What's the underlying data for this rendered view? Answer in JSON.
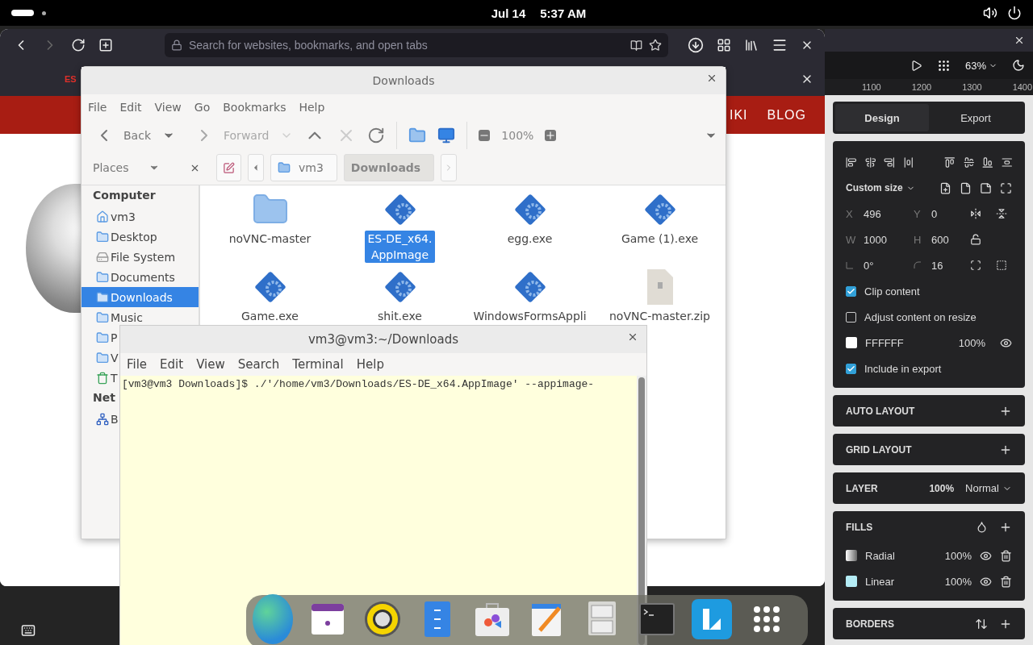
{
  "top_bar": {
    "date": "Jul 14",
    "time": "5:37 AM"
  },
  "browser": {
    "search_placeholder": "Search for websites, bookmarks, and open tabs",
    "tab_label": "ES",
    "site_nav": [
      "IKI",
      "BLOG"
    ]
  },
  "file_manager": {
    "title": "Downloads",
    "menu": [
      "File",
      "Edit",
      "View",
      "Go",
      "Bookmarks",
      "Help"
    ],
    "toolbar": {
      "back": "Back",
      "forward": "Forward",
      "forward_disabled": true,
      "zoom": "100%"
    },
    "places": "Places",
    "path": [
      {
        "label": "vm3",
        "selected": false
      },
      {
        "label": "Downloads",
        "selected": true
      }
    ],
    "sidebar": [
      {
        "heading": "Computer",
        "items": [
          {
            "label": "vm3",
            "kind": "home",
            "selected": false
          },
          {
            "label": "Desktop",
            "kind": "folder",
            "selected": false
          },
          {
            "label": "File System",
            "kind": "drive",
            "selected": false
          },
          {
            "label": "Documents",
            "kind": "folder",
            "selected": false
          },
          {
            "label": "Downloads",
            "kind": "folder",
            "selected": true
          },
          {
            "label": "Music",
            "kind": "folder",
            "selected": false
          },
          {
            "label": "P",
            "kind": "folder",
            "selected": false
          },
          {
            "label": "V",
            "kind": "folder",
            "selected": false
          },
          {
            "label": "T",
            "kind": "trash",
            "selected": false
          }
        ]
      },
      {
        "heading": "Net",
        "items": [
          {
            "label": "B",
            "kind": "network",
            "selected": false
          }
        ]
      }
    ],
    "files": [
      {
        "name": "noVNC-master",
        "kind": "folder",
        "selected": false
      },
      {
        "name": "ES-DE_x64.\nAppImage",
        "kind": "program",
        "selected": true
      },
      {
        "name": "egg.exe",
        "kind": "program",
        "selected": false
      },
      {
        "name": "Game (1).exe",
        "kind": "program",
        "selected": false
      },
      {
        "name": "Game.exe",
        "kind": "program",
        "selected": false
      },
      {
        "name": "shit.exe",
        "kind": "program",
        "selected": false
      },
      {
        "name": "WindowsFormsAppli",
        "kind": "program",
        "selected": false
      },
      {
        "name": "noVNC-master.zip",
        "kind": "archive",
        "selected": false
      }
    ]
  },
  "terminal": {
    "title": "vm3@vm3:~/Downloads",
    "menu": [
      "File",
      "Edit",
      "View",
      "Search",
      "Terminal",
      "Help"
    ],
    "lines": [
      "[vm3@vm3 Downloads]$ ./'/home/vm3/Downloads/ES-DE_x64.AppImage' --appimage-"
    ]
  },
  "design_app": {
    "zoom": "63%",
    "ruler": [
      "1100",
      "1200",
      "1300",
      "1400"
    ],
    "tabs": [
      {
        "label": "Design",
        "selected": true
      },
      {
        "label": "Export",
        "selected": false
      }
    ],
    "size_preset": "Custom size",
    "fields": [
      {
        "kind": "text",
        "label": "X",
        "value": "496"
      },
      {
        "kind": "text",
        "label": "Y",
        "value": "0"
      },
      {
        "kind": "text",
        "label": "W",
        "value": "1000"
      },
      {
        "kind": "text",
        "label": "H",
        "value": "600"
      },
      {
        "kind": "rotation",
        "value": "0°"
      },
      {
        "kind": "radius",
        "value": "16"
      }
    ],
    "rows": [
      {
        "kind": "checkbox",
        "label": "Clip content",
        "checked": true
      },
      {
        "kind": "checkbox",
        "label": "Adjust content on resize",
        "checked": false
      },
      {
        "kind": "color",
        "value": "FFFFFF",
        "opacity": "100%"
      },
      {
        "kind": "checkbox",
        "label": "Include in export",
        "checked": true
      }
    ],
    "sections": [
      {
        "kind": "plain",
        "title": "AUTO LAYOUT"
      },
      {
        "kind": "plain",
        "title": "GRID LAYOUT"
      },
      {
        "kind": "layer",
        "title": "LAYER",
        "opacity": "100%",
        "blend": "Normal"
      },
      {
        "kind": "fills",
        "title": "FILLS",
        "fills": [
          {
            "kind": "radial",
            "name": "Radial",
            "opacity": "100%"
          },
          {
            "kind": "linear",
            "name": "Linear",
            "opacity": "100%"
          }
        ]
      },
      {
        "kind": "borders",
        "title": "BORDERS"
      }
    ]
  }
}
